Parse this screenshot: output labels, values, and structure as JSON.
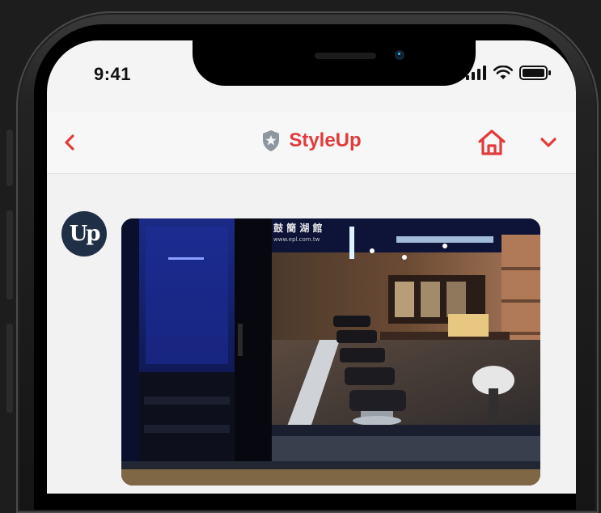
{
  "status_bar": {
    "time": "9:41"
  },
  "nav": {
    "title": "StyleUp"
  },
  "message": {
    "avatar_text": "Up",
    "image": {
      "sign_text": "鼓 簡 湖 館",
      "sign_url": "www.epl.com.tw"
    }
  },
  "colors": {
    "accent": "#e23b3b",
    "avatar_bg": "#1f2f45"
  }
}
